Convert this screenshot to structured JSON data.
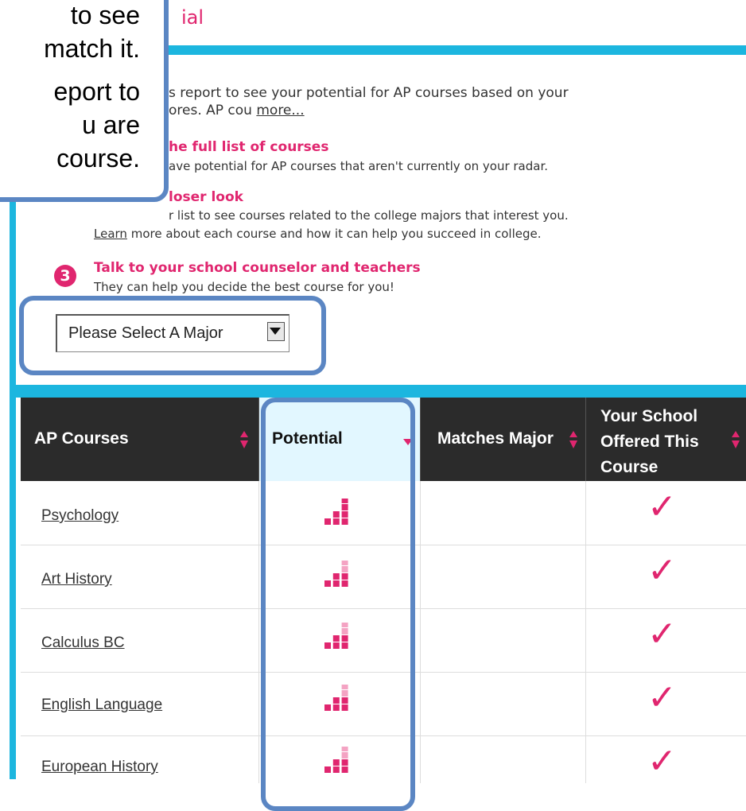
{
  "title_fragment": "ial",
  "tooltip": {
    "lines": [
      "to see",
      "match it.",
      "",
      "eport to",
      "u are",
      "course."
    ]
  },
  "intro": {
    "text": "s report to see your potential for AP courses based on your",
    "text2": "ores. AP cou",
    "more_link": "more..."
  },
  "steps": [
    {
      "heading": "he full list of courses",
      "sub": "ave potential for AP courses that aren't currently on your radar."
    },
    {
      "heading": "loser look",
      "sub": "r list to see courses related to the college majors that interest you.",
      "sub2_link": "Learn",
      "sub2": " more about each course and how it can help you succeed in college."
    },
    {
      "number": "3",
      "heading": "Talk to your school counselor and teachers",
      "sub": "They can help you decide the best course for you!"
    }
  ],
  "major_select": {
    "value": "Please Select A Major"
  },
  "table": {
    "headers": [
      "AP Courses",
      "Potential",
      "Matches Major",
      "Your School",
      "Offered This",
      "Course"
    ],
    "rows": [
      {
        "course": "Psychology",
        "potential_level": 4,
        "offered": "✓"
      },
      {
        "course": "Art History",
        "potential_level": 3,
        "offered": "✓"
      },
      {
        "course": "Calculus BC",
        "potential_level": 3,
        "offered": "✓"
      },
      {
        "course": "English Language",
        "potential_level": 3,
        "offered": "✓"
      },
      {
        "course": "European History",
        "potential_level": 3,
        "offered": "✓"
      }
    ]
  },
  "colors": {
    "accent": "#e0266f",
    "cyan": "#1cb6df",
    "highlight": "#5b86c3",
    "header_bg": "#2b2b2b",
    "potential_header_bg": "#e2f7ff"
  }
}
